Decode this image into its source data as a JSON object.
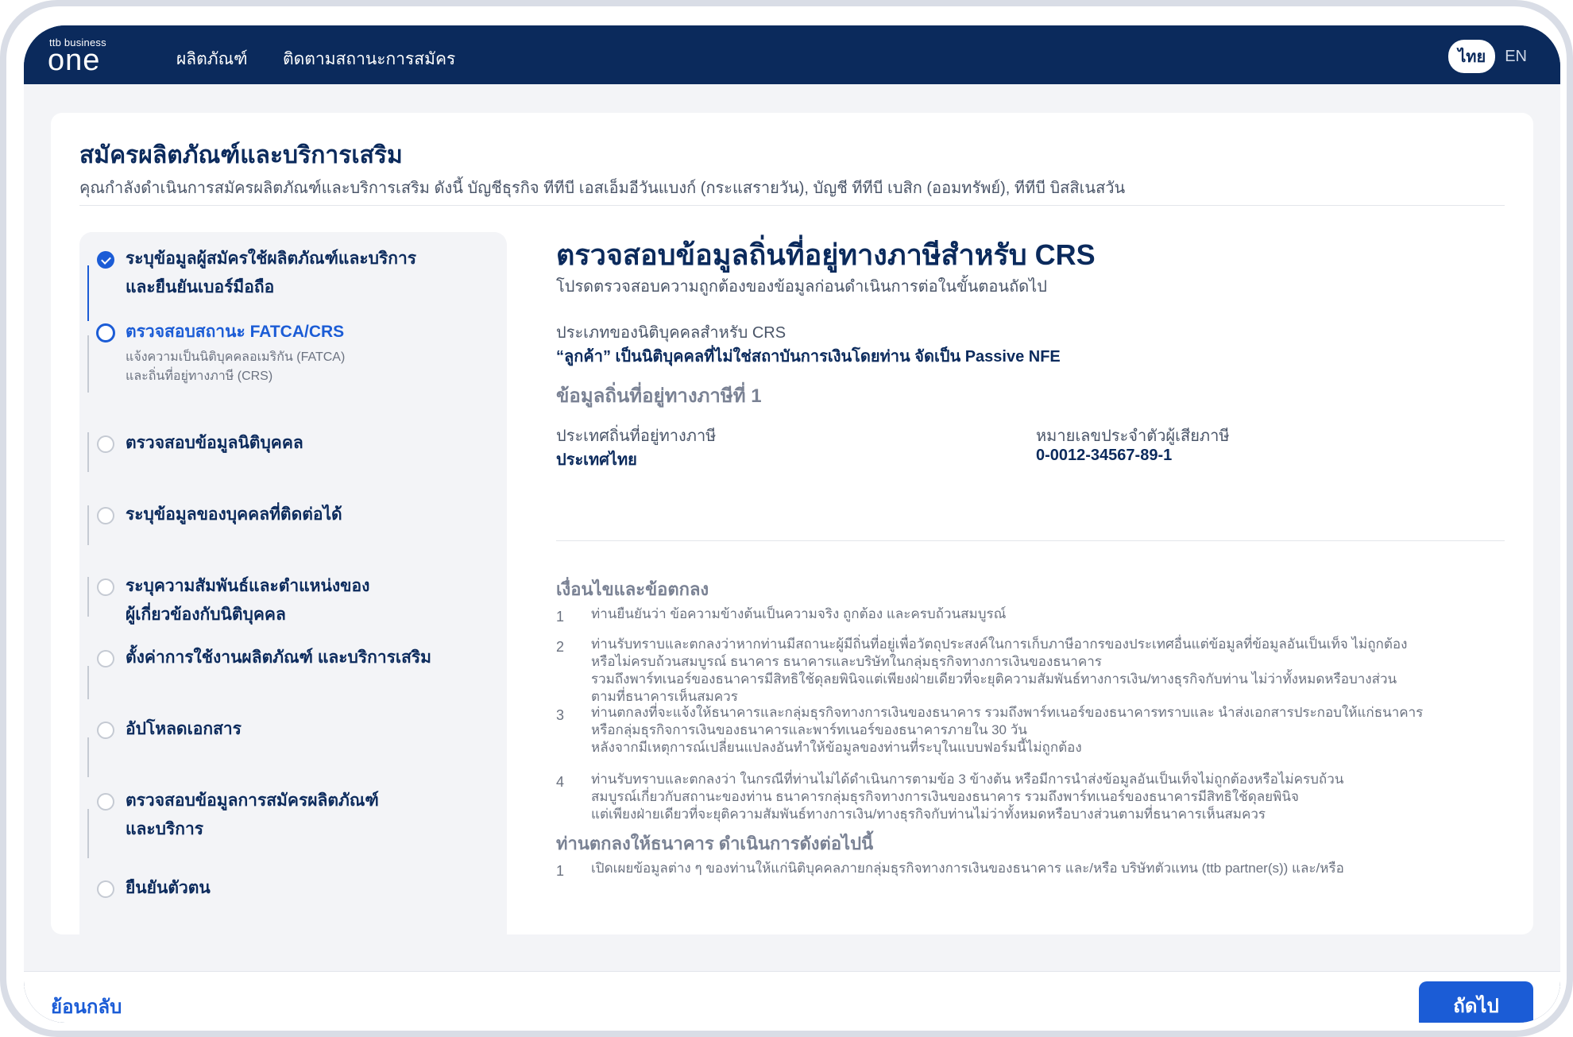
{
  "header": {
    "logo_small": "ttb business",
    "logo_big": "one",
    "nav": [
      "ผลิตภัณฑ์",
      "ติดตามสถานะการสมัคร"
    ],
    "lang_active": "ไทย",
    "lang_other": "EN"
  },
  "page": {
    "title": "สมัครผลิตภัณฑ์และบริการเสริม",
    "subtitle": "คุณกำลังดำเนินการสมัครผลิตภัณฑ์และบริการเสริม ดังนี้  บัญชีธุรกิจ ทีทีบี เอสเอ็มอีวันแบงก์ (กระแสรายวัน),  บัญชี ทีทีบี เบสิก (ออมทรัพย์),  ทีทีบี บิสสิเนสวัน"
  },
  "steps": [
    {
      "line1": "ระบุข้อมูลผู้สมัครใช้ผลิตภัณฑ์และบริการ",
      "line2": "และยืนยันเบอร์มือถือ",
      "status": "done"
    },
    {
      "line1": "ตรวจสอบสถานะ FATCA/CRS",
      "desc1": "แจ้งความเป็นนิติบุคคลอเมริกัน (FATCA)",
      "desc2": "และถิ่นที่อยู่ทางภาษี (CRS)",
      "status": "active"
    },
    {
      "line1": "ตรวจสอบข้อมูลนิติบุคคล",
      "status": "pending"
    },
    {
      "line1": "ระบุข้อมูลของบุคคลที่ติดต่อได้",
      "status": "pending"
    },
    {
      "line1": "ระบุความสัมพันธ์และตำแหน่งของ",
      "line2": "ผู้เกี่ยวข้องกับนิติบุคคล",
      "status": "pending"
    },
    {
      "line1": "ตั้งค่าการใช้งานผลิตภัณฑ์ และบริการเสริม",
      "status": "pending"
    },
    {
      "line1": "อัปโหลดเอกสาร",
      "status": "pending"
    },
    {
      "line1": "ตรวจสอบข้อมูลการสมัครผลิตภัณฑ์",
      "line2": "และบริการ",
      "status": "pending"
    },
    {
      "line1": "ยืนยันตัวตน",
      "status": "pending"
    }
  ],
  "main": {
    "title": "ตรวจสอบข้อมูลถิ่นที่อยู่ทางภาษีสำหรับ CRS",
    "subtitle": "โปรดตรวจสอบความถูกต้องของข้อมูลก่อนดำเนินการต่อในขั้นตอนถัดไป",
    "entity_type_label": "ประเภทของนิติบุคคลสำหรับ CRS",
    "entity_type_value": "“ลูกค้า” เป็นนิติบุคคลที่ไม่ใช่สถาบันการเงินโดยท่าน จัดเป็น Passive NFE",
    "section1": "ข้อมูลถิ่นที่อยู่ทางภาษีที่ 1",
    "country_label": "ประเทศถิ่นที่อยู่ทางภาษี",
    "country_value": "ประเทศไทย",
    "tin_label": "หมายเลขประจำตัวผู้เสียภาษี",
    "tin_value": "0-0012-34567-89-1",
    "terms_title": "เงื่อนไขและข้อตกลง",
    "terms": [
      {
        "num": "1",
        "lines": [
          "ท่านยืนยันว่า ข้อความข้างต้นเป็นความจริง ถูกต้อง และครบถ้วนสมบูรณ์"
        ]
      },
      {
        "num": "2",
        "lines": [
          "ท่านรับทราบและตกลงว่าหากท่านมีสถานะผู้มีถิ่นที่อยู่เพื่อวัตถุประสงค์ในการเก็บภาษีอากรของประเทศอื่นแต่ข้อมูลที่ข้อมูลอันเป็นเท็จ ไม่ถูกต้อง",
          "หรือไม่ครบถ้วนสมบูรณ์ ธนาคาร ธนาคารและบริษัทในกลุ่มธุรกิจทางการเงินของธนาคาร",
          "รวมถึงพาร์ทเนอร์ของธนาคารมีสิทธิใช้ดุลยพินิจแต่เพียงฝ่ายเดียวที่จะยุติความสัมพันธ์ทางการเงิน/ทางธุรกิจกับท่าน ไม่ว่าทั้งหมดหรือบางส่วน",
          "ตามที่ธนาคารเห็นสมควร"
        ]
      },
      {
        "num": "3",
        "lines": [
          "ท่านตกลงที่จะแจ้งให้ธนาคารและกลุ่มธุรกิจทางการเงินของธนาคาร รวมถึงพาร์ทเนอร์ของธนาคารทราบและ นำส่งเอกสารประกอบให้แก่ธนาคาร",
          "หรือกลุ่มธุรกิจการเงินของธนาคารและพาร์ทเนอร์ของธนาคารภายใน 30 วัน",
          "หลังจากมีเหตุการณ์เปลี่ยนแปลงอันทำให้ข้อมูลของท่านที่ระบุในแบบฟอร์มนี้ไม่ถูกต้อง"
        ]
      },
      {
        "num": "4",
        "lines": [
          "ท่านรับทราบและตกลงว่า ในกรณีที่ท่านไม่ได้ดำเนินการตามข้อ 3 ข้างต้น หรือมีการนำส่งข้อมูลอันเป็นเท็จไม่ถูกต้องหรือไม่ครบถ้วน",
          "สมบูรณ์เกี่ยวกับสถานะของท่าน ธนาคารกลุ่มธุรกิจทางการเงินของธนาคาร รวมถึงพาร์ทเนอร์ของธนาคารมีสิทธิใช้ดุลยพินิจ",
          "แต่เพียงฝ่ายเดียวที่จะยุติความสัมพันธ์ทางการเงิน/ทางธุรกิจกับท่านไม่ว่าทั้งหมดหรือบางส่วนตามที่ธนาคารเห็นสมควร"
        ]
      }
    ],
    "agree_title": "ท่านตกลงให้ธนาคาร ดำเนินการดังต่อไปนี้",
    "agree_item_num": "1",
    "agree_item_text": "เปิดเผยข้อมูลต่าง ๆ ของท่านให้แก่นิติบุคคลภายกลุ่มธุรกิจทางการเงินของธนาคาร และ/หรือ บริษัทตัวแทน (ttb partner(s)) และ/หรือ"
  },
  "footer": {
    "back": "ย้อนกลับ",
    "next": "ถัดไป"
  },
  "colors": {
    "brand_navy": "#0b2a5c",
    "accent_blue": "#1b5cd6"
  }
}
